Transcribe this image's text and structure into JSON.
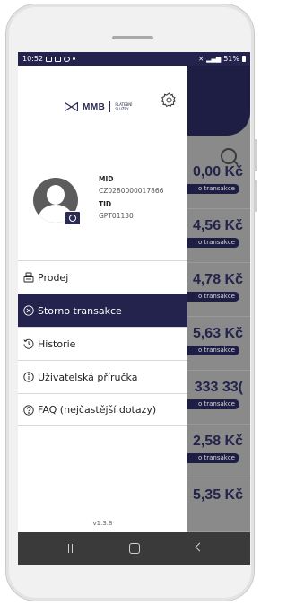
{
  "status_bar": {
    "time": "10:52",
    "battery": "51%"
  },
  "drawer": {
    "brand": {
      "name": "MMB",
      "sub": "PLATEBNÍ SLUŽBY"
    },
    "merchant": {
      "mid_label": "MID",
      "mid_value": "CZ0280000017866",
      "tid_label": "TID",
      "tid_value": "GPT01130"
    },
    "menu": [
      {
        "label": "Prodej",
        "icon": "register-icon",
        "active": false
      },
      {
        "label": "Storno transakce",
        "icon": "cancel-circle-icon",
        "active": true
      },
      {
        "label": "Historie",
        "icon": "history-icon",
        "active": false
      },
      {
        "label": "Uživatelská příručka",
        "icon": "info-circle-icon",
        "active": false
      },
      {
        "label": "FAQ (nejčastější dotazy)",
        "icon": "help-circle-icon",
        "active": false
      }
    ],
    "version": "v1.3.8"
  },
  "background_list": {
    "rows": [
      {
        "amount": "0,00 Kč",
        "tag": "o transakce"
      },
      {
        "amount": "4,56 Kč",
        "tag": "o transakce"
      },
      {
        "amount": "4,78 Kč",
        "tag": "o transakce"
      },
      {
        "amount": "5,63 Kč",
        "tag": "o transakce"
      },
      {
        "amount": "333 33(",
        "tag": "o transakce"
      },
      {
        "amount": "2,58 Kč",
        "tag": "o transakce"
      },
      {
        "amount": "5,35 Kč",
        "tag": ""
      }
    ]
  },
  "colors": {
    "brand_dark": "#23234d",
    "scrim": "#8a8a8a",
    "nav_bar": "#3a3a3a"
  }
}
